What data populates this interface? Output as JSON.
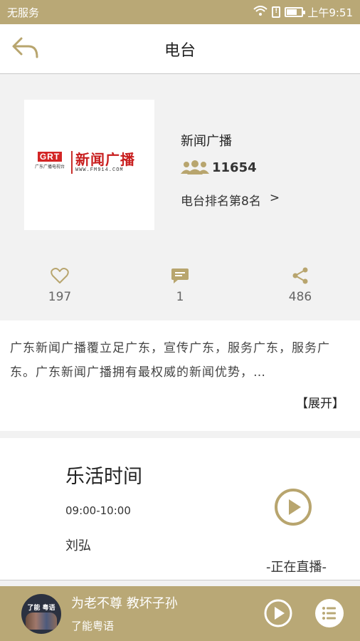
{
  "status_bar": {
    "carrier": "无服务",
    "time": "上午9:51",
    "sim_label": "!"
  },
  "header": {
    "title": "电台"
  },
  "station": {
    "logo": {
      "brand": "GRT",
      "brand_sub": "广东广播电视台",
      "name": "新闻广播",
      "url": "WWW.FM914.COM"
    },
    "name": "新闻广播",
    "fans": "11654",
    "rank": "电台排名第8名",
    "rank_arrow": ">"
  },
  "actions": {
    "likes": "197",
    "comments": "1",
    "shares": "486"
  },
  "description": {
    "text": "广东新闻广播覆立足广东，宣传广东，服务广东，服务广东。广东新闻广播拥有最权威的新闻优势，…",
    "expand": "【展开】"
  },
  "program": {
    "title": "乐活时间",
    "time": "09:00-10:00",
    "host": "刘弘",
    "live": "-正在直播-"
  },
  "player": {
    "title": "为老不尊 教坏子孙",
    "subtitle": "了能粤语",
    "cover_text": "了能 粤语"
  },
  "colors": {
    "accent": "#b9a876",
    "icon_gold": "#b8a56e"
  }
}
